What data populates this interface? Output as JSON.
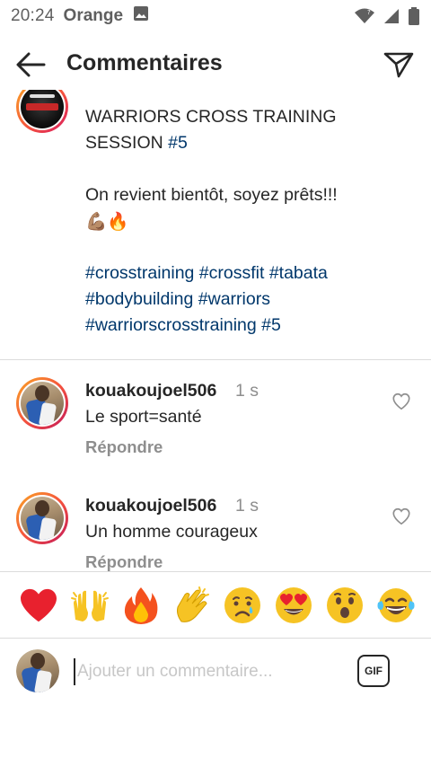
{
  "status_bar": {
    "time": "20:24",
    "carrier": "Orange",
    "icons": [
      "image-icon",
      "wifi-icon",
      "signal-icon",
      "battery-icon"
    ]
  },
  "header": {
    "title": "Commentaires",
    "back_icon": "arrow-left-icon",
    "send_icon": "paper-plane-icon"
  },
  "caption": {
    "partial_top_line": "",
    "lines": [
      {
        "text": "WARRIORS CROSS TRAINING"
      },
      {
        "text": "SESSION ",
        "tag": "#5"
      },
      {
        "text": ""
      },
      {
        "text": "On revient bientôt, soyez prêts!!!"
      },
      {
        "text": "💪🏽🔥"
      },
      {
        "text": ""
      },
      {
        "tags": "#crosstraining #crossfit #tabata"
      },
      {
        "tags": "#bodybuilding #warriors"
      },
      {
        "tags": "#warriorscrosstraining #5"
      }
    ]
  },
  "comments": [
    {
      "username": "kouakoujoel506",
      "time": "1 s",
      "text": "Le sport=santé",
      "reply_label": "Répondre"
    },
    {
      "username": "kouakoujoel506",
      "time": "1 s",
      "text": "Un homme courageux",
      "reply_label": "Répondre"
    }
  ],
  "quick_emojis": [
    "❤️",
    "🙌",
    "🔥",
    "👏",
    "😢",
    "😍",
    "😮",
    "😂"
  ],
  "input": {
    "placeholder": "Ajouter un commentaire...",
    "value": "",
    "gif_label": "GIF"
  },
  "colors": {
    "hashtag": "#00376b",
    "text": "#262626",
    "muted": "#8e8e8e",
    "divider": "#dbdbdb"
  }
}
